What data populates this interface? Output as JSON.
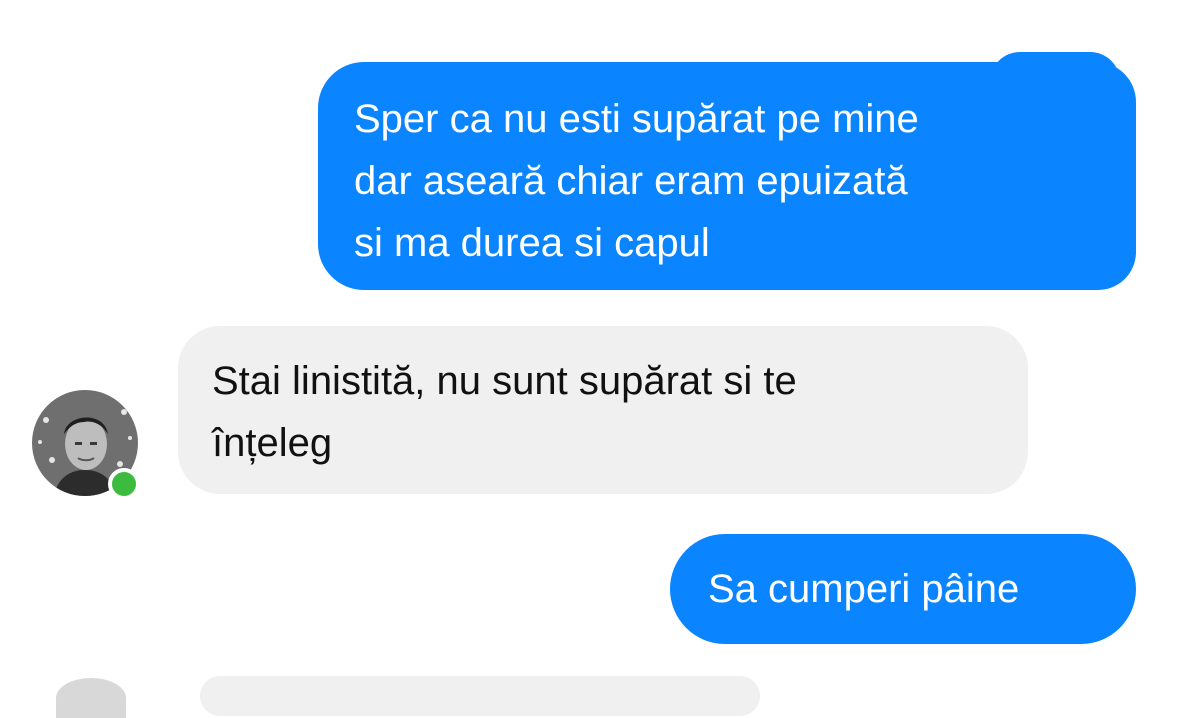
{
  "conversation": {
    "messages": [
      {
        "direction": "outgoing",
        "text": "Sper ca nu esti supărat pe mine\ndar aseară chiar eram epuizată\nsi ma durea si capul"
      },
      {
        "direction": "incoming",
        "text": "Stai linistită,  nu sunt supărat si te\nînțeleg"
      },
      {
        "direction": "outgoing",
        "text": "Sa cumperi pâine"
      }
    ],
    "contact": {
      "avatar_icon": "contact-avatar-photo",
      "online_status_color": "#3dbb3f"
    }
  },
  "colors": {
    "outgoing_bubble": "#0a84ff",
    "incoming_bubble": "#f0f0f0"
  }
}
